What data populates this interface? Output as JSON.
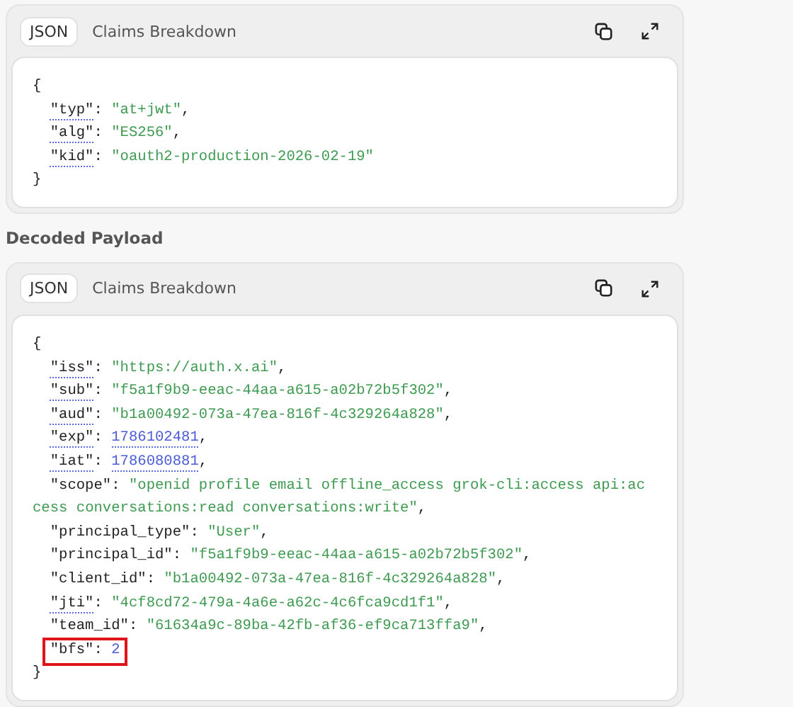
{
  "header_section": {
    "tabs": [
      {
        "label": "JSON",
        "selected": true
      },
      {
        "label": "Claims Breakdown",
        "selected": false
      }
    ],
    "open": "{",
    "close": "}",
    "lines": [
      {
        "key": "\"typ\"",
        "sep": ":",
        "value": "\"at+jwt\"",
        "end": ",",
        "kind": "string",
        "annotated": true,
        "highlighted": false
      },
      {
        "key": "\"alg\"",
        "sep": ":",
        "value": "\"ES256\"",
        "end": ",",
        "kind": "string",
        "annotated": true,
        "highlighted": false
      },
      {
        "key": "\"kid\"",
        "sep": ":",
        "value": "\"oauth2-production-2026-02-19\"",
        "kind": "string",
        "annotated": true,
        "highlighted": false
      }
    ]
  },
  "payload_title": "Decoded Payload",
  "payload_section": {
    "tabs": [
      {
        "label": "JSON",
        "selected": true
      },
      {
        "label": "Claims Breakdown",
        "selected": false
      }
    ],
    "open": "{",
    "close": "}",
    "lines": [
      {
        "key": "\"iss\"",
        "sep": ":",
        "value": "\"https://auth.x.ai\"",
        "end": ",",
        "kind": "string",
        "annotated": true,
        "highlighted": false
      },
      {
        "key": "\"sub\"",
        "sep": ":",
        "value": "\"f5a1f9b9-eeac-44aa-a615-a02b72b5f302\"",
        "end": ",",
        "kind": "string",
        "annotated": true,
        "highlighted": false
      },
      {
        "key": "\"aud\"",
        "sep": ":",
        "value": "\"b1a00492-073a-47ea-816f-4c329264a828\"",
        "end": ",",
        "kind": "string",
        "annotated": true,
        "highlighted": false
      },
      {
        "key": "\"exp\"",
        "sep": ":",
        "value": "1786102481",
        "end": ",",
        "kind": "number",
        "annotated": true,
        "highlighted": false
      },
      {
        "key": "\"iat\"",
        "sep": ":",
        "value": "1786080881",
        "end": ",",
        "kind": "number",
        "annotated": true,
        "highlighted": false
      },
      {
        "key": "\"scope\"",
        "sep": ":",
        "value": "\"openid profile email offline_access grok-cli:access api:access conversations:read conversations:write\"",
        "end": ",",
        "kind": "string",
        "annotated": false,
        "highlighted": false
      },
      {
        "key": "\"principal_type\"",
        "sep": ":",
        "value": "\"User\"",
        "end": ",",
        "kind": "string",
        "annotated": false,
        "highlighted": false
      },
      {
        "key": "\"principal_id\"",
        "sep": ":",
        "value": "\"f5a1f9b9-eeac-44aa-a615-a02b72b5f302\"",
        "end": ",",
        "kind": "string",
        "annotated": false,
        "highlighted": false
      },
      {
        "key": "\"client_id\"",
        "sep": ":",
        "value": "\"b1a00492-073a-47ea-816f-4c329264a828\"",
        "end": ",",
        "kind": "string",
        "annotated": false,
        "highlighted": false
      },
      {
        "key": "\"jti\"",
        "sep": ":",
        "value": "\"4cf8cd72-479a-4a6e-a62c-4c6fca9cd1f1\"",
        "end": ",",
        "kind": "string",
        "annotated": true,
        "highlighted": false
      },
      {
        "key": "\"team_id\"",
        "sep": ":",
        "value": "\"61634a9c-89ba-42fb-af36-ef9ca713ffa9\"",
        "end": ",",
        "kind": "string",
        "annotated": false,
        "highlighted": false
      },
      {
        "key": "\"bfs\"",
        "sep": ":",
        "value": "2",
        "kind": "number",
        "annotated": false,
        "highlighted": true
      }
    ]
  }
}
